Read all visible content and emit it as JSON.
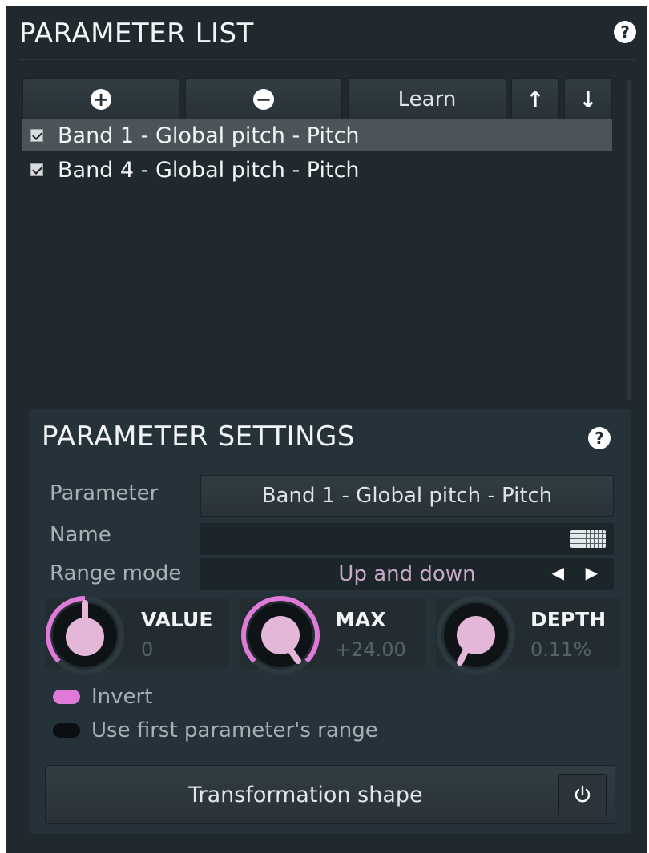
{
  "parameter_list": {
    "title": "PARAMETER LIST",
    "help_glyph": "?",
    "toolbar": {
      "add_icon": "plus-circle-icon",
      "add_glyph": "+",
      "remove_icon": "minus-circle-icon",
      "remove_glyph": "−",
      "learn_label": "Learn",
      "move_up_icon": "arrow-up-icon",
      "move_up_glyph": "↑",
      "move_down_icon": "arrow-down-icon",
      "move_down_glyph": "↓"
    },
    "items": [
      {
        "label": "Band 1 - Global pitch - Pitch",
        "checked": true,
        "selected": true
      },
      {
        "label": "Band 4 - Global pitch - Pitch",
        "checked": true,
        "selected": false
      }
    ]
  },
  "parameter_settings": {
    "title": "PARAMETER SETTINGS",
    "help_glyph": "?",
    "parameter_label": "Parameter",
    "parameter_value": "Band 1 - Global pitch - Pitch",
    "name_label": "Name",
    "name_value": "",
    "name_icon": "keyboard-icon",
    "range_mode_label": "Range mode",
    "range_mode_value": "Up and down",
    "range_prev_glyph": "◀",
    "range_next_glyph": "▶",
    "knobs": [
      {
        "title": "VALUE",
        "value": "0"
      },
      {
        "title": "MAX",
        "value": "+24.00"
      },
      {
        "title": "DEPTH",
        "value": "0.11%"
      }
    ],
    "invert_label": "Invert",
    "invert_on": true,
    "use_first_range_label": "Use first parameter's range",
    "use_first_range_on": false,
    "transformation_shape_label": "Transformation shape",
    "power_icon": "power-icon"
  },
  "colors": {
    "accent": "#e07ad8",
    "knob_face": "#e4b6d8",
    "background": "#1f292e"
  }
}
